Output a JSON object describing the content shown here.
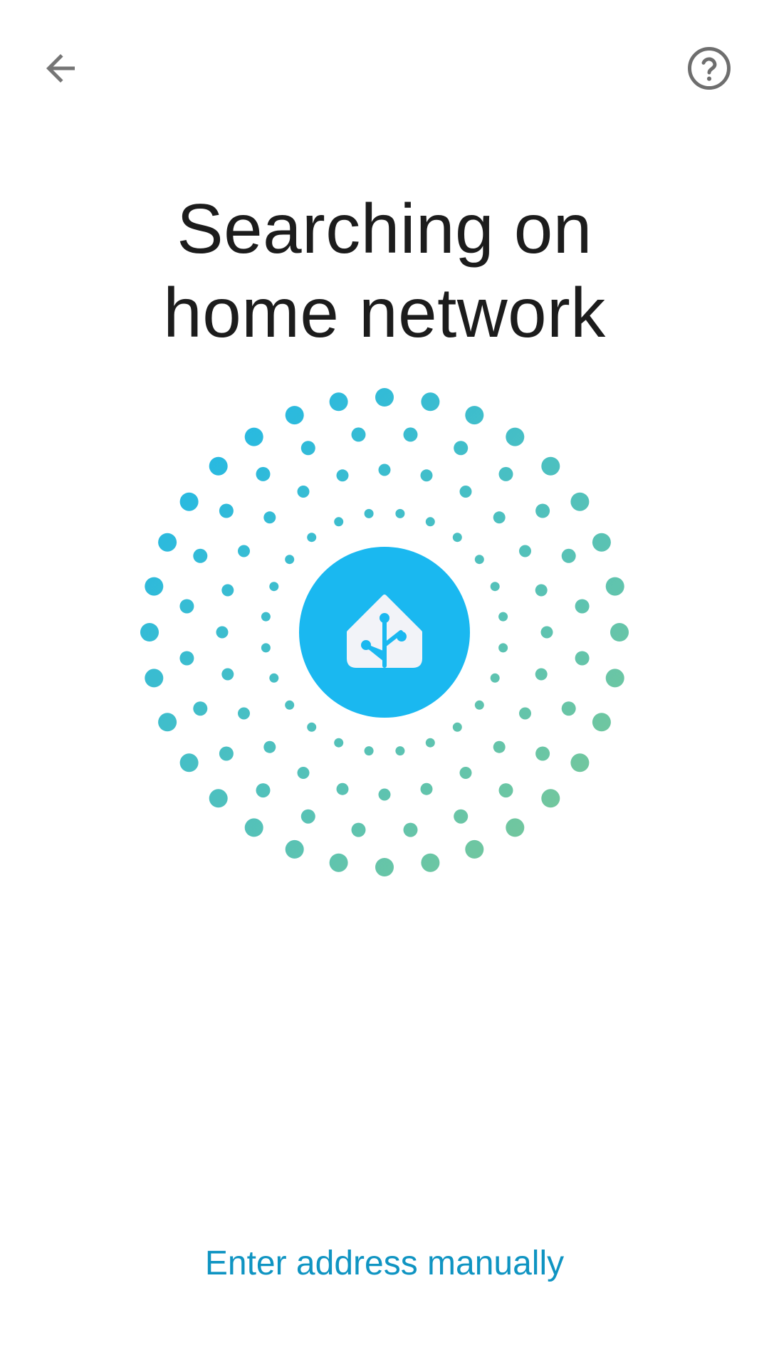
{
  "header": {
    "back_icon": "arrow-left-icon",
    "help_icon": "help-circle-icon",
    "icon_color": "#757575"
  },
  "title": {
    "line1": "Searching on",
    "line2": "home network"
  },
  "graphic": {
    "center_icon": "home-assistant-logo-icon",
    "center_color": "#1ab8f0",
    "dot_color_start": "#22b8e6",
    "dot_color_end": "#78c898"
  },
  "footer": {
    "manual_link_label": "Enter address manually",
    "link_color": "#0f94c2"
  }
}
